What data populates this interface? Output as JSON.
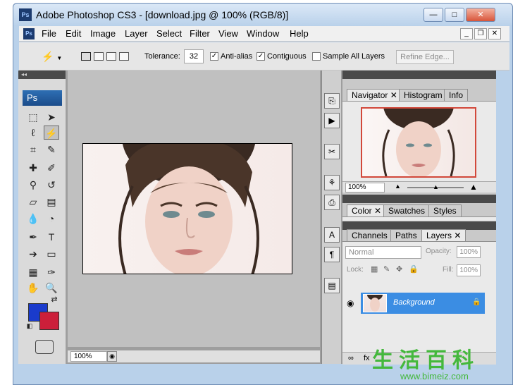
{
  "window": {
    "title": "Adobe Photoshop CS3 - [download.jpg @ 100% (RGB/8)]",
    "app_icon": "Ps",
    "colors": {
      "titlebar": "#b9d1ea",
      "accent": "#3b8de3",
      "fg": "#1a3bcc",
      "bg": "#cc1f3a"
    }
  },
  "menubar": {
    "items": [
      "File",
      "Edit",
      "Image",
      "Layer",
      "Select",
      "Filter",
      "View",
      "Window",
      "Help"
    ],
    "doc_icon": "Ps"
  },
  "options": {
    "tolerance_label": "Tolerance:",
    "tolerance_value": "32",
    "antialias_label": "Anti-alias",
    "antialias_checked": true,
    "contiguous_label": "Contiguous",
    "contiguous_checked": true,
    "sample_all_label": "Sample All Layers",
    "sample_all_checked": false,
    "refine_label": "Refine Edge..."
  },
  "toolbox": {
    "logo": "Ps",
    "tools": [
      {
        "name": "marquee-tool",
        "icon": "dashed-rect"
      },
      {
        "name": "move-tool",
        "icon": "move-arrow"
      },
      {
        "name": "lasso-tool",
        "icon": "lasso"
      },
      {
        "name": "magic-wand-tool",
        "icon": "magic-wand"
      },
      {
        "name": "crop-tool",
        "icon": "crop"
      },
      {
        "name": "slice-tool",
        "icon": "slice"
      },
      {
        "name": "healing-brush-tool",
        "icon": "bandage"
      },
      {
        "name": "brush-tool",
        "icon": "brush"
      },
      {
        "name": "clone-stamp-tool",
        "icon": "stamp"
      },
      {
        "name": "history-brush-tool",
        "icon": "history-brush"
      },
      {
        "name": "eraser-tool",
        "icon": "eraser"
      },
      {
        "name": "gradient-tool",
        "icon": "gradient"
      },
      {
        "name": "blur-tool",
        "icon": "drop"
      },
      {
        "name": "dodge-tool",
        "icon": "dodge"
      },
      {
        "name": "pen-tool",
        "icon": "pen"
      },
      {
        "name": "type-tool",
        "icon": "T"
      },
      {
        "name": "path-selection-tool",
        "icon": "arrow"
      },
      {
        "name": "shape-tool",
        "icon": "rect"
      },
      {
        "name": "notes-tool",
        "icon": "note"
      },
      {
        "name": "eyedropper-tool",
        "icon": "eyedropper"
      },
      {
        "name": "hand-tool",
        "icon": "hand"
      },
      {
        "name": "zoom-tool",
        "icon": "magnifier"
      }
    ]
  },
  "document": {
    "zoom": "100%"
  },
  "navigator": {
    "tabs": [
      "Navigator",
      "Histogram",
      "Info"
    ],
    "zoom": "100%"
  },
  "color_panel": {
    "tabs": [
      "Color",
      "Swatches",
      "Styles"
    ]
  },
  "layers_panel": {
    "tabs": [
      "Channels",
      "Paths",
      "Layers"
    ],
    "blend_mode": "Normal",
    "opacity_label": "Opacity:",
    "opacity_value": "100%",
    "lock_label": "Lock:",
    "fill_label": "Fill:",
    "fill_value": "100%",
    "layers": [
      {
        "name": "Background",
        "locked": true,
        "visible": true
      }
    ]
  },
  "watermark": {
    "chars": "生活百科",
    "url": "www.bimeiz.com"
  }
}
